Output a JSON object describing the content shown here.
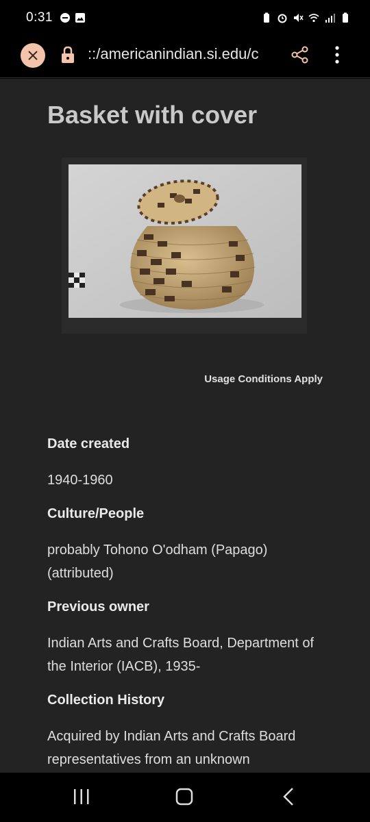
{
  "status_bar": {
    "time": "0:31"
  },
  "browser": {
    "url": "::/americanindian.si.edu/c"
  },
  "page": {
    "title": "Basket with cover",
    "usage_conditions": "Usage Conditions Apply",
    "fields": [
      {
        "label": "Date created",
        "value": "1940-1960"
      },
      {
        "label": "Culture/People",
        "value": "probably Tohono O'odham (Papago) (attributed)"
      },
      {
        "label": "Previous owner",
        "value": "Indian Arts and Crafts Board, Department of the Interior (IACB), 1935-"
      },
      {
        "label": "Collection History",
        "value": "Acquired by Indian Arts and Crafts Board representatives from an unknown"
      }
    ]
  },
  "colors": {
    "close_button_bg": "#f4c3ab",
    "page_bg": "#232323"
  }
}
